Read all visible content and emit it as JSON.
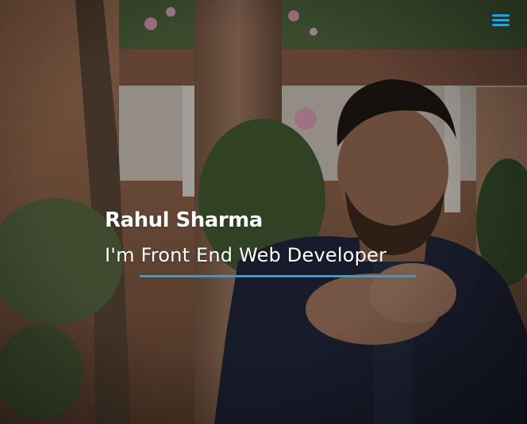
{
  "hero": {
    "name": "Rahul Sharma",
    "tagline": "I'm Front End Web Developer"
  },
  "nav": {
    "menu_icon": "hamburger-menu-icon"
  },
  "colors": {
    "accent": "#2a9fd8",
    "text": "#ffffff",
    "overlay": "rgba(20,18,16,0.35)"
  }
}
